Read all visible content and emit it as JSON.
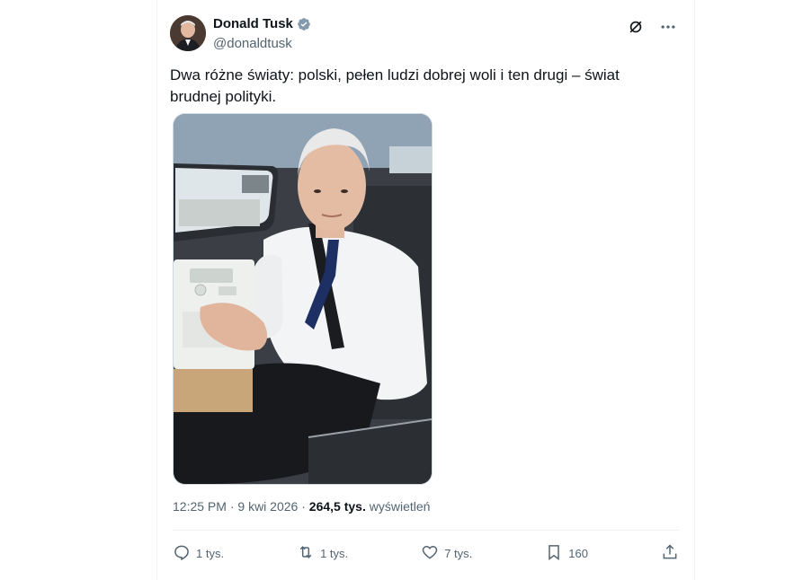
{
  "author": {
    "name": "Donald Tusk",
    "handle": "@donaldtusk"
  },
  "tweet": {
    "text": "Dwa różne światy: polski, pełen ludzi dobrej woli i ten drugi – świat brudnej polityki."
  },
  "meta": {
    "time": "12:25 PM",
    "separator1": " · ",
    "date": "9 kwi 2026",
    "separator2": " · ",
    "views_count": "264,5 tys.",
    "views_label": " wyświetleń"
  },
  "actions": {
    "replies": "1 tys.",
    "reposts": "1 tys.",
    "likes": "7 tys.",
    "bookmarks": "160"
  },
  "icons": {
    "verified": "verified-badge-icon",
    "grok": "grok-icon",
    "more": "more-icon",
    "reply": "reply-icon",
    "repost": "repost-icon",
    "like": "heart-icon",
    "bookmark": "bookmark-icon",
    "share": "share-icon"
  },
  "colors": {
    "verified": "#829aab",
    "muted": "#536471",
    "text": "#0f1419"
  }
}
